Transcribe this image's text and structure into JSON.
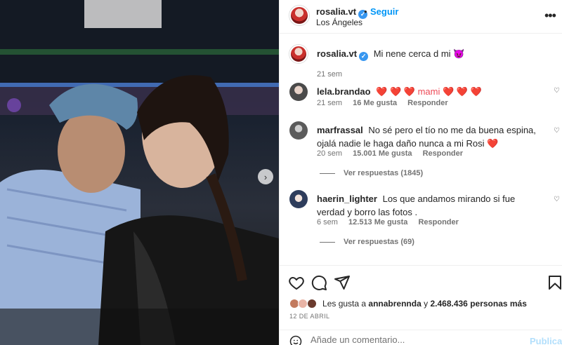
{
  "post": {
    "author": "rosalia.vt",
    "follow_label": "Seguir",
    "separator": "•",
    "location": "Los Ángeles",
    "more_label": "•••",
    "caption": "Mi nene cerca d mi 😈",
    "caption_time": "21 sem"
  },
  "comments": [
    {
      "username": "lela.brandao",
      "text": "❤️ ❤️ ❤️   mami  ❤️ ❤️ ❤️",
      "time": "21 sem",
      "likes": "16 Me gusta",
      "reply_label": "Responder"
    },
    {
      "username": "marfrassal",
      "text": "No sé pero el tío no me da buena espina, ojalá nadie le haga daño nunca a mi Rosi ❤️",
      "time": "20 sem",
      "likes": "15.001 Me gusta",
      "reply_label": "Responder",
      "replies_label": "Ver respuestas (1845)"
    },
    {
      "username": "haerin_lighter",
      "text": "Los que andamos mirando si fue verdad y borro las fotos .",
      "time": "6 sem",
      "likes": "12.513 Me gusta",
      "reply_label": "Responder",
      "replies_label": "Ver respuestas (69)"
    }
  ],
  "likes_summary": {
    "prefix": "Les gusta a",
    "user": "annabrennda",
    "middle": "y",
    "count": "2.468.436 personas más"
  },
  "date": "12 DE ABRIL",
  "comment_box": {
    "placeholder": "Añade un comentario...",
    "publish_label": "Publicar"
  },
  "icons": {
    "like": "heart-icon",
    "comment": "comment-icon",
    "share": "paper-plane-icon",
    "save": "bookmark-icon",
    "emoji": "smiley-icon",
    "next": "chevron-right-icon"
  },
  "colors": {
    "accent": "#0095f6",
    "verified": "#3897f0",
    "muted": "#737373",
    "publish_disabled": "#b2dffc"
  }
}
